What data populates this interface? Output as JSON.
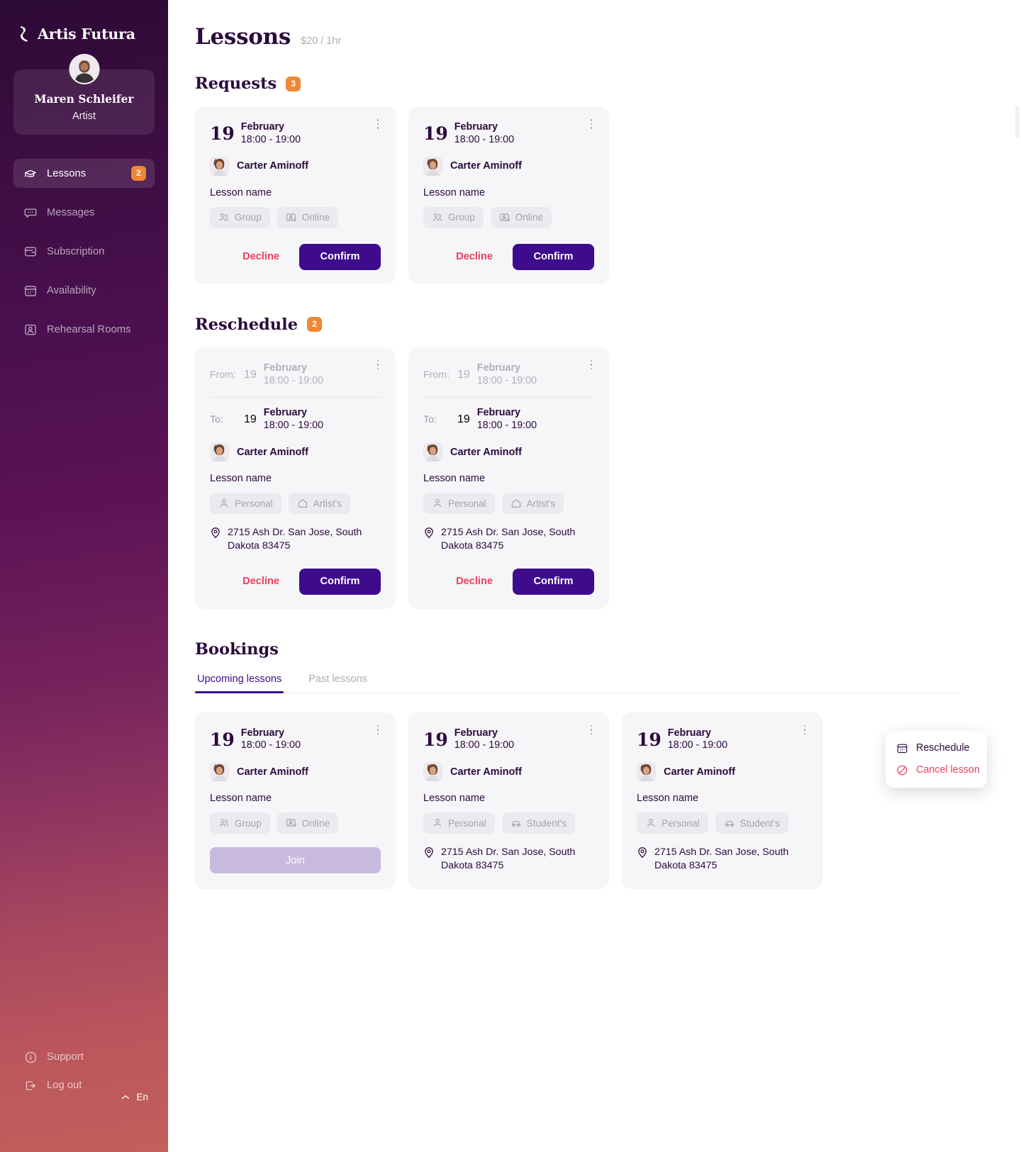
{
  "sidebar": {
    "brand": {
      "name": "Artis Futura",
      "mark_icon": "logo-mark-icon"
    },
    "profile": {
      "name": "Maren Schleifer",
      "role": "Artist",
      "avatar_icon": "avatar-image"
    },
    "nav": [
      {
        "label": "Lessons",
        "icon": "graduation-cap-icon",
        "badge": "2",
        "active": true
      },
      {
        "label": "Messages",
        "icon": "chat-bubble-icon",
        "badge": "",
        "active": false
      },
      {
        "label": "Subscription",
        "icon": "wallet-icon",
        "badge": "",
        "active": false
      },
      {
        "label": "Availability",
        "icon": "calendar-icon",
        "badge": "",
        "active": false
      },
      {
        "label": "Rehearsal Rooms",
        "icon": "user-square-icon",
        "badge": "",
        "active": false
      }
    ],
    "bottom": [
      {
        "label": "Support",
        "icon": "info-circle-icon"
      },
      {
        "label": "Log out",
        "icon": "logout-icon"
      }
    ],
    "language": {
      "value": "En",
      "chevron_icon": "chevron-up-icon"
    }
  },
  "header": {
    "title": "Lessons",
    "price": "$20 / 1hr"
  },
  "sections": {
    "requests": {
      "title": "Requests",
      "count": "3"
    },
    "reschedule": {
      "title": "Reschedule",
      "count": "2"
    },
    "bookings": {
      "title": "Bookings"
    }
  },
  "labels": {
    "lesson_name": "Lesson name",
    "decline": "Decline",
    "confirm": "Confirm",
    "join": "Join",
    "from": "From:",
    "to": "To:",
    "address": "2715 Ash Dr. San Jose, South Dakota 83475",
    "student": "Carter Aminoff",
    "day": "19",
    "month": "February",
    "time": "18:00 - 19:00"
  },
  "requests": [
    {
      "day": "19",
      "month": "February",
      "time": "18:00 - 19:00",
      "student": "Carter Aminoff",
      "lesson_name": "Lesson name",
      "tags": [
        {
          "label": "Group",
          "icon": "people-icon"
        },
        {
          "label": "Online",
          "icon": "video-person-icon"
        }
      ],
      "decline": "Decline",
      "confirm": "Confirm"
    },
    {
      "day": "19",
      "month": "February",
      "time": "18:00 - 19:00",
      "student": "Carter Aminoff",
      "lesson_name": "Lesson name",
      "tags": [
        {
          "label": "Group",
          "icon": "people-icon"
        },
        {
          "label": "Online",
          "icon": "video-person-icon"
        }
      ],
      "decline": "Decline",
      "confirm": "Confirm"
    }
  ],
  "reschedules": [
    {
      "from_label": "From:",
      "from_day": "19",
      "from_month": "February",
      "from_time": "18:00 - 19:00",
      "to_label": "To:",
      "to_day": "19",
      "to_month": "February",
      "to_time": "18:00 - 19:00",
      "student": "Carter Aminoff",
      "lesson_name": "Lesson name",
      "tags": [
        {
          "label": "Personal",
          "icon": "person-icon"
        },
        {
          "label": "Artist's",
          "icon": "home-icon"
        }
      ],
      "address": "2715 Ash Dr. San Jose, South Dakota 83475",
      "decline": "Decline",
      "confirm": "Confirm"
    },
    {
      "from_label": "From:",
      "from_day": "19",
      "from_month": "February",
      "from_time": "18:00 - 19:00",
      "to_label": "To:",
      "to_day": "19",
      "to_month": "February",
      "to_time": "18:00 - 19:00",
      "student": "Carter Aminoff",
      "lesson_name": "Lesson name",
      "tags": [
        {
          "label": "Personal",
          "icon": "person-icon"
        },
        {
          "label": "Artist's",
          "icon": "home-icon"
        }
      ],
      "address": "2715 Ash Dr. San Jose, South Dakota 83475",
      "decline": "Decline",
      "confirm": "Confirm"
    }
  ],
  "booking_tabs": [
    {
      "label": "Upcoming lessons",
      "active": true
    },
    {
      "label": "Past lessons",
      "active": false
    }
  ],
  "bookings": [
    {
      "day": "19",
      "month": "February",
      "time": "18:00 - 19:00",
      "student": "Carter Aminoff",
      "lesson_name": "Lesson name",
      "tags": [
        {
          "label": "Group",
          "icon": "people-icon"
        },
        {
          "label": "Online",
          "icon": "video-person-icon"
        }
      ],
      "join": "Join"
    },
    {
      "day": "19",
      "month": "February",
      "time": "18:00 - 19:00",
      "student": "Carter Aminoff",
      "lesson_name": "Lesson name",
      "tags": [
        {
          "label": "Personal",
          "icon": "person-icon"
        },
        {
          "label": "Student's",
          "icon": "car-icon"
        }
      ],
      "address": "2715 Ash Dr. San Jose, South Dakota 83475"
    },
    {
      "day": "19",
      "month": "February",
      "time": "18:00 - 19:00",
      "student": "Carter Aminoff",
      "lesson_name": "Lesson name",
      "tags": [
        {
          "label": "Personal",
          "icon": "person-icon"
        },
        {
          "label": "Student's",
          "icon": "car-icon"
        }
      ],
      "address": "2715 Ash Dr. San Jose, South Dakota 83475"
    }
  ],
  "context_menu": {
    "items": [
      {
        "label": "Reschedule",
        "icon": "calendar-icon",
        "danger": false
      },
      {
        "label": "Cancel lesson",
        "icon": "prohibited-icon",
        "danger": true
      }
    ]
  },
  "colors": {
    "brand_purple": "#3d0b8c",
    "title_ink": "#2b0a3d",
    "accent_orange": "#ef8733",
    "danger_red": "#ef3e5e",
    "card_bg": "#f6f5f8",
    "tag_bg": "#eceaef",
    "join_disabled": "#c8bade"
  }
}
